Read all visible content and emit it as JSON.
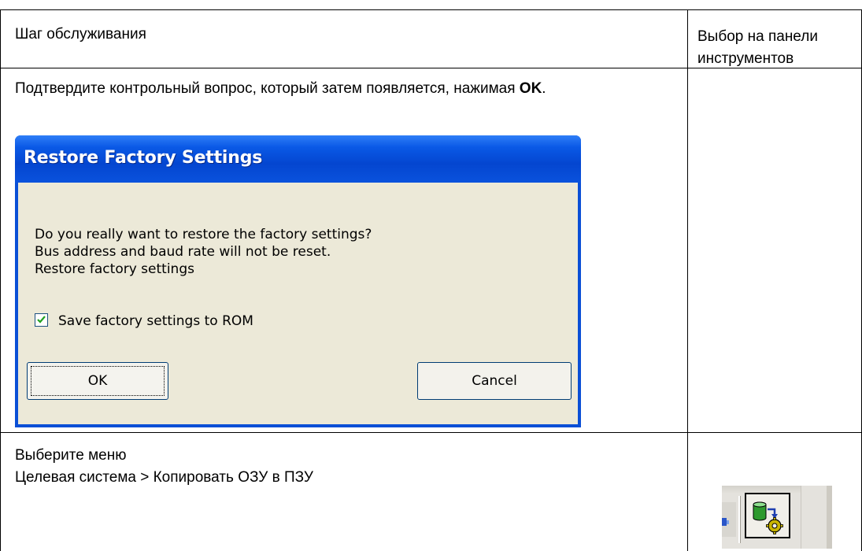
{
  "table": {
    "header": {
      "step_label": "Шаг обслуживания",
      "toolbar_label": "Выбор на панели инструментов"
    },
    "rows": [
      {
        "text_before": "Подтвердите контрольный вопрос, который затем появляется, нажимая ",
        "text_bold": "OK",
        "text_after": "."
      },
      {
        "line1": "Выберите меню",
        "line2": "Целевая система > Копировать ОЗУ в ПЗУ"
      }
    ]
  },
  "dialog": {
    "title": "Restore Factory Settings",
    "message_lines": [
      "Do you really want to restore the factory settings?",
      "Bus address and baud rate will not be reset.",
      "Restore factory settings"
    ],
    "checkbox": {
      "label": "Save factory settings to ROM",
      "checked": true
    },
    "ok_label": "OK",
    "cancel_label": "Cancel"
  },
  "toolbar": {
    "icon": "copy-ram-to-rom-icon"
  },
  "colors": {
    "titlebar": "#0a59e6",
    "dialog_bg": "#ece9d8",
    "cylinder_green": "#2e9a2e",
    "gear_yellow": "#c8b400"
  }
}
